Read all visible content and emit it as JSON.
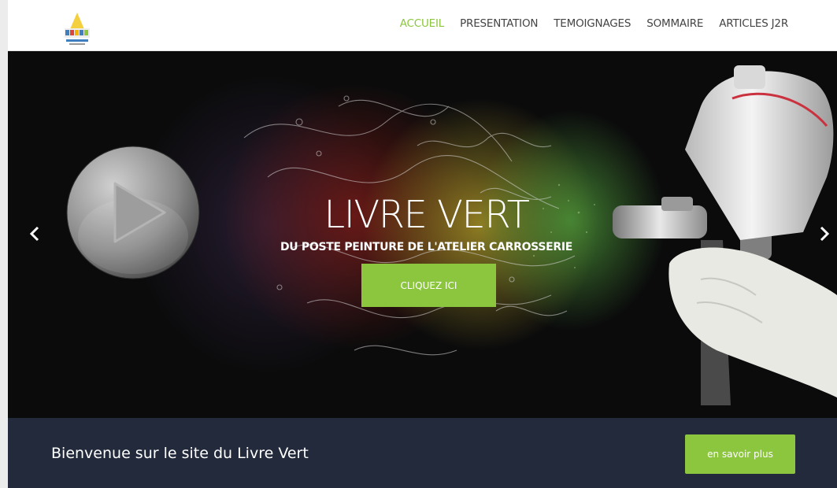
{
  "nav": {
    "items": [
      {
        "label": "ACCUEIL",
        "active": true
      },
      {
        "label": "PRESENTATION"
      },
      {
        "label": "TEMOIGNAGES"
      },
      {
        "label": "SOMMAIRE"
      },
      {
        "label": "ARTICLES J2R"
      }
    ]
  },
  "hero": {
    "title": "LIVRE VERT",
    "subtitle": "DU POSTE PEINTURE DE L'ATELIER CARROSSERIE",
    "cta_label": "CLIQUEZ ICI",
    "prev_icon": "chevron-left-icon",
    "next_icon": "chevron-right-icon",
    "play_icon": "play-icon"
  },
  "welcome": {
    "text": "Bienvenue sur le site du Livre Vert",
    "button_label": "en savoir plus"
  },
  "colors": {
    "accent": "#8cc63f",
    "footer_bg": "#222a3c",
    "hero_bg": "#0c0c0d"
  }
}
